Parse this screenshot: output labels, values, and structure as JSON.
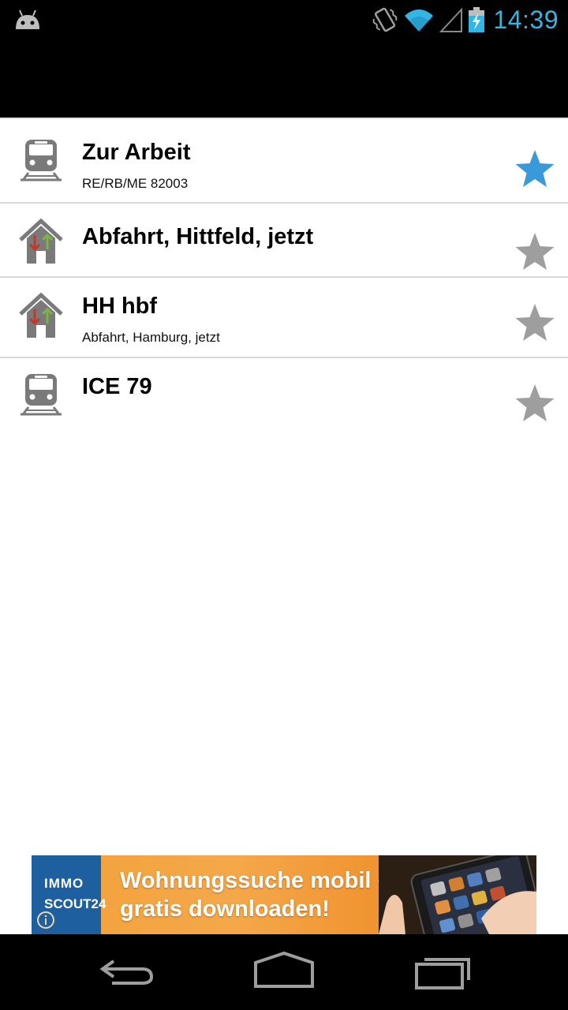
{
  "status_bar": {
    "time": "14:39",
    "icons": [
      "android-icon",
      "vibrate-icon",
      "wifi-icon",
      "signal-icon",
      "battery-charging-icon"
    ],
    "clock_color": "#33b5e5"
  },
  "list": {
    "items": [
      {
        "title": "Zur Arbeit",
        "subtitle": "RE/RB/ME 82003",
        "icon": "train-icon",
        "favorite": true
      },
      {
        "title": "Abfahrt, Hittfeld, jetzt",
        "subtitle": "",
        "icon": "station-icon",
        "favorite": false
      },
      {
        "title": "HH hbf",
        "subtitle": "Abfahrt, Hamburg, jetzt",
        "icon": "station-icon",
        "favorite": false
      },
      {
        "title": "ICE 79",
        "subtitle": "",
        "icon": "train-icon",
        "favorite": false
      }
    ],
    "star_active_color": "#3a9ad9",
    "star_inactive_color": "#9e9e9e"
  },
  "ad": {
    "logo_line1": "IMMO",
    "logo_line2": "SCOUT24",
    "line1": "Wohnungssuche mobil –",
    "line2": "gratis downloaden!"
  },
  "nav_bar": {
    "buttons": [
      "back-icon",
      "home-icon",
      "recent-apps-icon"
    ]
  }
}
